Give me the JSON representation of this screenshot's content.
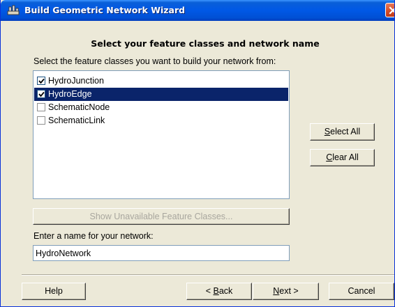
{
  "window": {
    "title": "Build Geometric Network Wizard"
  },
  "page": {
    "heading": "Select your feature classes and network name",
    "list_instruction": "Select the feature classes you want to build your network from:",
    "name_label": "Enter a name for your network:"
  },
  "feature_classes": [
    {
      "label": "HydroJunction",
      "checked": true,
      "selected": false
    },
    {
      "label": "HydroEdge",
      "checked": true,
      "selected": true
    },
    {
      "label": "SchematicNode",
      "checked": false,
      "selected": false
    },
    {
      "label": "SchematicLink",
      "checked": false,
      "selected": false
    }
  ],
  "buttons": {
    "select_all": {
      "key": "S",
      "rest": "elect All"
    },
    "clear_all": {
      "key": "C",
      "rest": "lear All"
    },
    "show_unavailable": "Show Unavailable Feature Classes...",
    "help": "Help",
    "back": {
      "pre": "< ",
      "key": "B",
      "rest": "ack"
    },
    "next": {
      "key": "N",
      "rest": "ext >"
    },
    "cancel": "Cancel"
  },
  "network_name": {
    "value": "HydroNetwork"
  },
  "colors": {
    "title_bar": "#0058e6",
    "dialog_face": "#ece9d8",
    "selection": "#0a246a",
    "disabled_text": "#a8a69e"
  },
  "icons": {
    "app": "network-wizard-icon",
    "close": "close-icon",
    "check": "checkmark-icon"
  }
}
